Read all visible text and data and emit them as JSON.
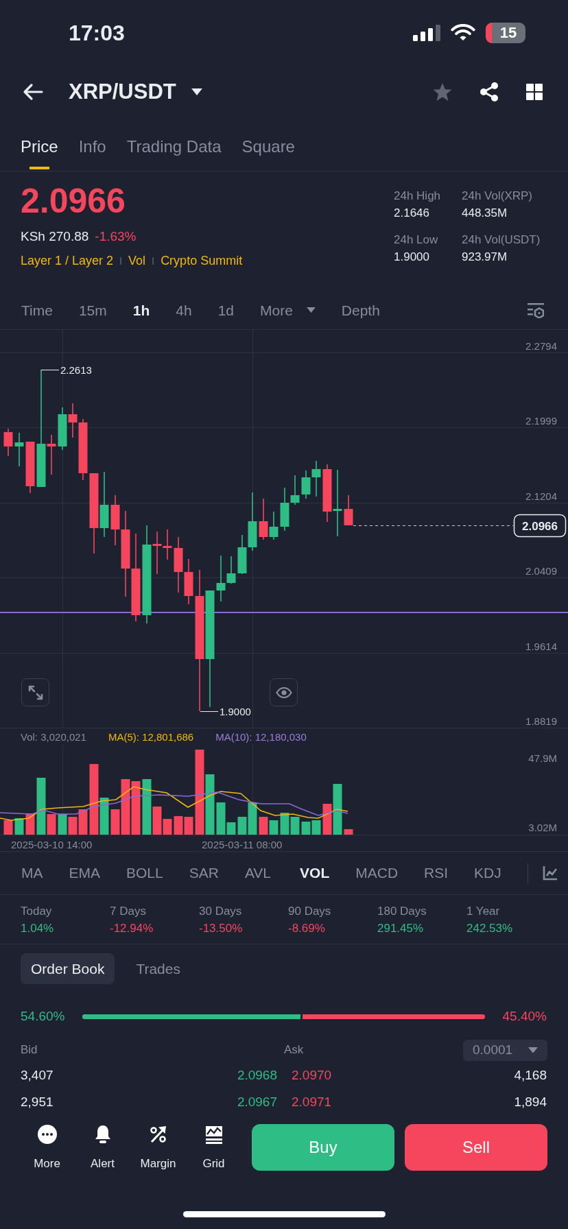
{
  "status_bar": {
    "time": "17:03",
    "battery": "15"
  },
  "header": {
    "title": "XRP/USDT"
  },
  "tabs": [
    {
      "label": "Price",
      "selected": true
    },
    {
      "label": "Info",
      "selected": false
    },
    {
      "label": "Trading Data",
      "selected": false
    },
    {
      "label": "Square",
      "selected": false
    }
  ],
  "ticker": {
    "price": "2.0966",
    "rising": false,
    "fiat_price": "KSh 270.88",
    "change": "-1.63%",
    "tags": [
      "Layer 1 / Layer 2",
      "Vol",
      "Crypto Summit"
    ],
    "stats": [
      {
        "label": "24h High",
        "value": "2.1646"
      },
      {
        "label": "24h Vol(XRP)",
        "value": "448.35M"
      },
      {
        "label": "24h Low",
        "value": "1.9000"
      },
      {
        "label": "24h Vol(USDT)",
        "value": "923.97M"
      }
    ]
  },
  "intervals": [
    {
      "label": "Time",
      "kind": "option",
      "selected": false
    },
    {
      "label": "15m",
      "kind": "option",
      "selected": false
    },
    {
      "label": "1h",
      "kind": "option",
      "selected": true
    },
    {
      "label": "4h",
      "kind": "option",
      "selected": false
    },
    {
      "label": "1d",
      "kind": "option",
      "selected": false
    },
    {
      "label": "More",
      "kind": "menu",
      "selected": false
    },
    {
      "label": "Depth",
      "kind": "option",
      "selected": false
    }
  ],
  "price_chart": {
    "price_ticks": [
      "2.2794",
      "2.1999",
      "2.1204",
      "2.0409",
      "1.9614",
      "1.8819"
    ],
    "last_price": "2.0966",
    "high_marker": "2.2613",
    "low_marker": "1.9000"
  },
  "volume_chart": {
    "volume": "Vol: 3,020,021",
    "ma5": "MA(5): 12,801,686",
    "ma10": "MA(10): 12,180,030",
    "volume_ticks": [
      "47.9M",
      "3.02M"
    ],
    "time_labels": [
      "2025-03-10 14:00",
      "2025-03-11 08:00"
    ]
  },
  "main_indicators": [
    {
      "label": "MA",
      "selected": false
    },
    {
      "label": "EMA",
      "selected": false
    },
    {
      "label": "BOLL",
      "selected": false
    },
    {
      "label": "SAR",
      "selected": false
    },
    {
      "label": "AVL",
      "selected": false
    }
  ],
  "sub_indicators": [
    {
      "label": "VOL",
      "selected": true
    },
    {
      "label": "MACD",
      "selected": false
    },
    {
      "label": "RSI",
      "selected": false
    },
    {
      "label": "KDJ",
      "selected": false
    }
  ],
  "performance": [
    {
      "period": "Today",
      "change": "1.04%",
      "rising": true
    },
    {
      "period": "7 Days",
      "change": "-12.94%",
      "rising": false
    },
    {
      "period": "30 Days",
      "change": "-13.50%",
      "rising": false
    },
    {
      "period": "90 Days",
      "change": "-8.69%",
      "rising": false
    },
    {
      "period": "180 Days",
      "change": "291.45%",
      "rising": true
    },
    {
      "period": "1 Year",
      "change": "242.53%",
      "rising": true
    }
  ],
  "order_book": {
    "tabs": [
      {
        "label": "Order Book",
        "selected": true
      },
      {
        "label": "Trades",
        "selected": false
      }
    ],
    "bid_share": "54.60%",
    "ask_share": "45.40%",
    "level": 0.546,
    "bid_header": "Bid",
    "ask_header": "Ask",
    "precision": "0.0001",
    "rows": [
      {
        "bid_amount": "3,407",
        "bid_price": "2.0968",
        "ask_price": "2.0970",
        "ask_amount": "4,168"
      },
      {
        "bid_amount": "2,951",
        "bid_price": "2.0967",
        "ask_price": "2.0971",
        "ask_amount": "1,894"
      }
    ]
  },
  "bottom_bar": {
    "actions": [
      {
        "label": "More"
      },
      {
        "label": "Alert"
      },
      {
        "label": "Margin"
      },
      {
        "label": "Grid"
      }
    ],
    "buy": "Buy",
    "sell": "Sell"
  }
}
